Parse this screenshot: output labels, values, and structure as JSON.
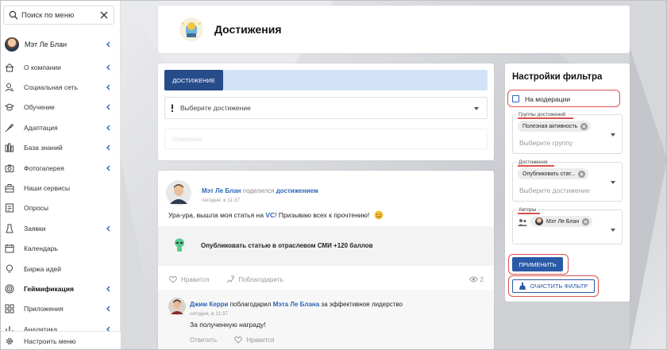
{
  "sidebar": {
    "search_placeholder": "Поиск по меню",
    "user_name": "Мэт Ле Блан",
    "items": [
      {
        "label": "О компании",
        "icon": "home-icon",
        "has_chevron": true
      },
      {
        "label": "Социальная сеть",
        "icon": "users-icon",
        "has_chevron": true
      },
      {
        "label": "Обучение",
        "icon": "graduation-cap-icon",
        "has_chevron": true
      },
      {
        "label": "Адаптация",
        "icon": "rocket-icon",
        "has_chevron": true
      },
      {
        "label": "База знаний",
        "icon": "library-icon",
        "has_chevron": true
      },
      {
        "label": "Фотогалерея",
        "icon": "camera-icon",
        "has_chevron": true
      },
      {
        "label": "Наши сервисы",
        "icon": "services-icon",
        "has_chevron": false
      },
      {
        "label": "Опросы",
        "icon": "survey-icon",
        "has_chevron": false
      },
      {
        "label": "Заявки",
        "icon": "request-icon",
        "has_chevron": true
      },
      {
        "label": "Календарь",
        "icon": "calendar-icon",
        "has_chevron": false
      },
      {
        "label": "Биржа идей",
        "icon": "lightbulb-icon",
        "has_chevron": false
      },
      {
        "label": "Геймификация",
        "icon": "target-icon",
        "has_chevron": true,
        "active": true
      },
      {
        "label": "Приложения",
        "icon": "apps-grid-icon",
        "has_chevron": true
      },
      {
        "label": "Аналитика",
        "icon": "analytics-icon",
        "has_chevron": true
      }
    ],
    "settings_label": "Настроить меню"
  },
  "header": {
    "title": "Достижения"
  },
  "form": {
    "tab_label": "ДОСТИЖЕНИЕ",
    "select_placeholder": "Выберите достижение",
    "description_placeholder": "Описание"
  },
  "post": {
    "author": "Мэт Ле Блан",
    "verb": "поделился",
    "object": "достижением",
    "time": "сегодня, в 11:37",
    "text_before": "Ура-ура, вышла моя статья на ",
    "text_link": "VC",
    "text_after": "! Призываю всех к прочтению!",
    "achievement": "Опубликовать статью в отраслевом СМИ +120 баллов",
    "like_label": "Нравится",
    "thank_label": "Поблагодарить",
    "views": "2"
  },
  "comment": {
    "author": "Джим Керри",
    "verb": "поблагодарил",
    "target": "Мэта Ле Блана",
    "reason": "за эффективное лидерство",
    "time": "сегодня, в 11:37",
    "text": "За полученную награду!",
    "reply_label": "Ответить",
    "like_label": "Нравится"
  },
  "filter": {
    "title": "Настройки фильтра",
    "moderation_label": "На модерации",
    "groups": {
      "legend": "Группы достижений",
      "chip": "Полезная активность",
      "placeholder": "Выберите группу"
    },
    "achievements": {
      "legend": "Достижения",
      "chip": "Опубликовать стат...",
      "placeholder": "Выберите достижение"
    },
    "authors": {
      "legend": "Авторы",
      "chip": "Мэт Ле Блан"
    },
    "apply_label": "ПРИМЕНИТЬ",
    "clear_label": "ОЧИСТИТЬ ФИЛЬТР"
  },
  "colors": {
    "accent": "#274c8a",
    "link": "#2c66b8",
    "highlight": "#d9534f"
  }
}
